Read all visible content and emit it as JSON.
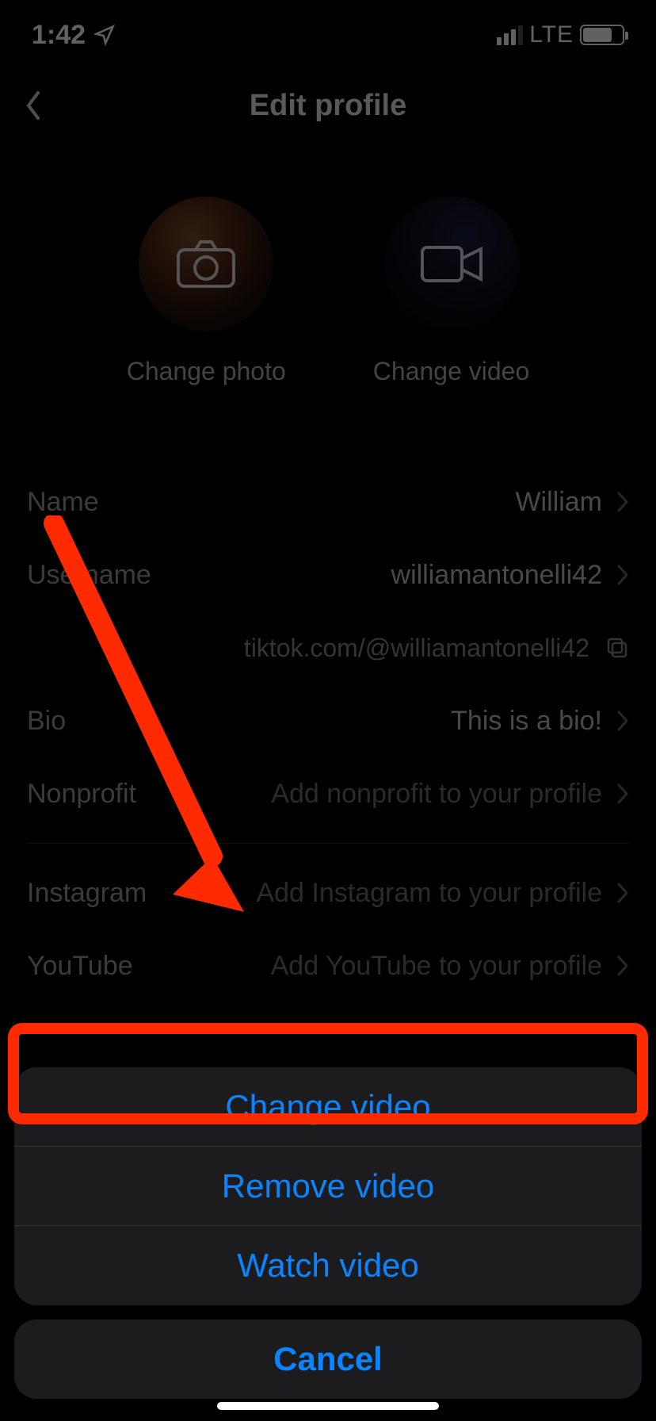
{
  "status": {
    "time": "1:42",
    "network_label": "LTE"
  },
  "nav": {
    "title": "Edit profile"
  },
  "media": {
    "photo_label": "Change photo",
    "video_label": "Change video"
  },
  "rows": {
    "name": {
      "label": "Name",
      "value": "William"
    },
    "username": {
      "label": "Username",
      "value": "williamantonelli42"
    },
    "link": {
      "text": "tiktok.com/@williamantonelli42"
    },
    "bio": {
      "label": "Bio",
      "value": "This is a bio!"
    },
    "nonprofit": {
      "label": "Nonprofit",
      "placeholder": "Add nonprofit to your profile"
    },
    "instagram": {
      "label": "Instagram",
      "placeholder": "Add Instagram to your profile"
    },
    "youtube": {
      "label": "YouTube",
      "placeholder": "Add YouTube to your profile"
    }
  },
  "sheet": {
    "change": "Change video",
    "remove": "Remove video",
    "watch": "Watch video",
    "cancel": "Cancel"
  },
  "annotation": {
    "highlight_target": "remove-video-button",
    "highlight_color": "#ff2a00"
  }
}
